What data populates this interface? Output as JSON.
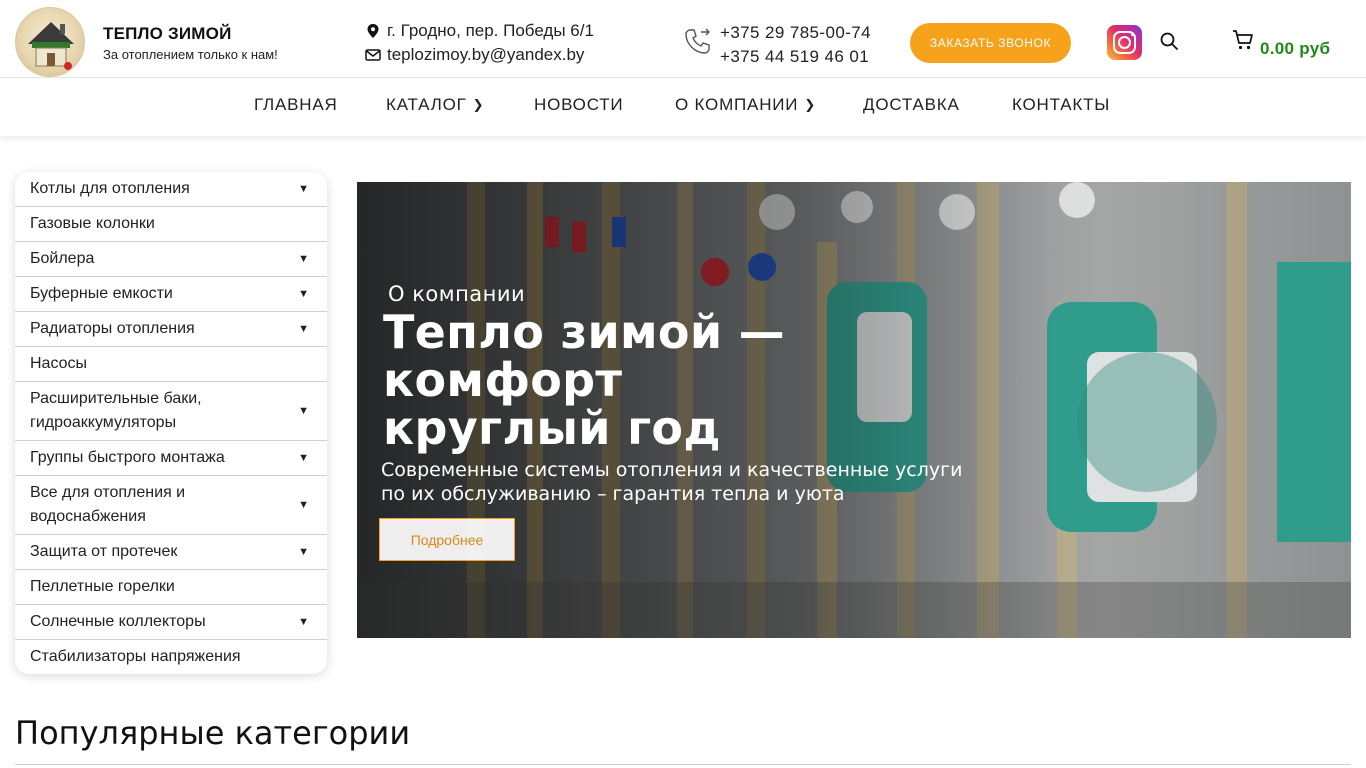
{
  "header": {
    "brand_title": "ТЕПЛО ЗИМОЙ",
    "brand_subtitle": "За отоплением только к нам!",
    "address": "г. Гродно, пер. Победы 6/1",
    "email": "teplozimoy.by@yandex.by",
    "phones": [
      "+375 29 785-00-74",
      "+375 44 519 46 01"
    ],
    "call_button": "ЗАКАЗАТЬ ЗВОНОК",
    "cart_total": "0.00 руб",
    "icons": {
      "address": "map-marker-icon",
      "email": "envelope-icon",
      "phone": "phone-icon",
      "instagram": "instagram-icon",
      "search": "search-icon",
      "cart": "cart-icon"
    }
  },
  "nav": {
    "items": [
      {
        "label": "ГЛАВНАЯ",
        "has_submenu": false
      },
      {
        "label": "КАТАЛОГ",
        "has_submenu": true
      },
      {
        "label": "НОВОСТИ",
        "has_submenu": false
      },
      {
        "label": "О КОМПАНИИ",
        "has_submenu": true
      },
      {
        "label": "ДОСТАВКА",
        "has_submenu": false
      },
      {
        "label": "КОНТАКТЫ",
        "has_submenu": false
      }
    ]
  },
  "sidebar": {
    "items": [
      {
        "label": "Котлы для отопления",
        "has_submenu": true
      },
      {
        "label": "Газовые колонки",
        "has_submenu": false
      },
      {
        "label": "Бойлера",
        "has_submenu": true
      },
      {
        "label": "Буферные емкости",
        "has_submenu": true
      },
      {
        "label": "Радиаторы отопления",
        "has_submenu": true
      },
      {
        "label": "Насосы",
        "has_submenu": false
      },
      {
        "label": "Расширительные баки, гидроаккумуляторы",
        "has_submenu": true
      },
      {
        "label": "Группы быстрого монтажа",
        "has_submenu": true
      },
      {
        "label": "Все для отопления и водоснабжения",
        "has_submenu": true
      },
      {
        "label": "Защита от протечек",
        "has_submenu": true
      },
      {
        "label": "Пеллетные горелки",
        "has_submenu": false
      },
      {
        "label": "Солнечные коллекторы",
        "has_submenu": true
      },
      {
        "label": "Стабилизаторы напряжения",
        "has_submenu": false
      }
    ],
    "arrow_glyph": "▼"
  },
  "hero": {
    "subtitle": "О компании",
    "title": "Тепло зимой — комфорт круглый год",
    "description": "Современные системы отопления и качественные услуги по их обслуживанию – гарантия тепла и уюта",
    "button": "Подробнее"
  },
  "sections": {
    "popular_title": "Популярные категории"
  },
  "colors": {
    "accent": "#f7a21b",
    "price": "#1f8a19"
  }
}
